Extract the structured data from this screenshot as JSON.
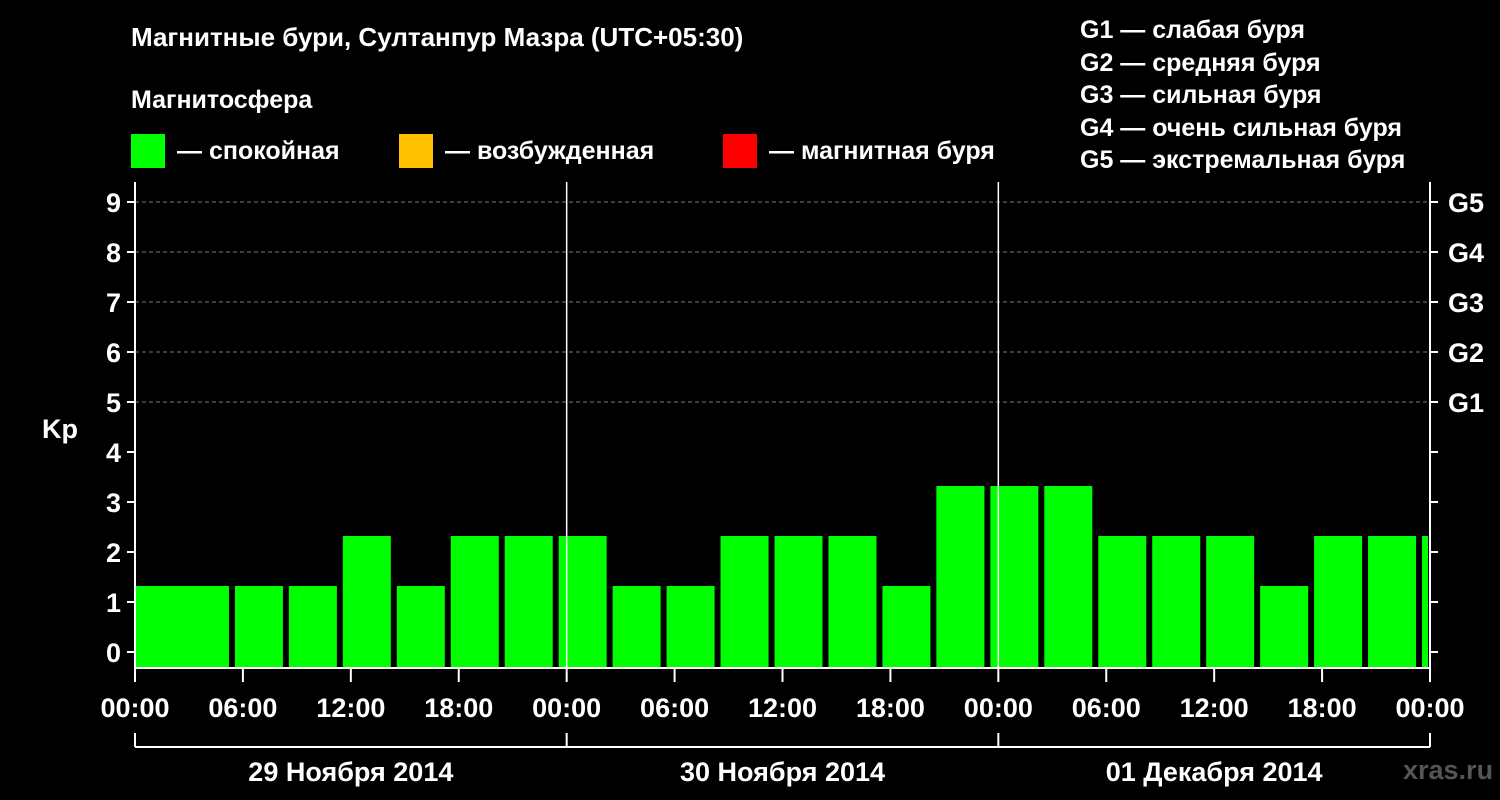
{
  "header": {
    "title": "Магнитные бури, Султанпур Мазра (UTC+05:30)",
    "magnetosphere_title": "Магнитосфера"
  },
  "legend": [
    {
      "color": "#00ff00",
      "label": "— спокойная"
    },
    {
      "color": "#ffc000",
      "label": "— возбужденная"
    },
    {
      "color": "#ff0000",
      "label": "— магнитная буря"
    }
  ],
  "g_legend": [
    "G1 — слабая буря",
    "G2 — средняя буря",
    "G3 — сильная буря",
    "G4 — очень сильная буря",
    "G5 — экстремальная буря"
  ],
  "watermark": "xras.ru",
  "chart_data": {
    "type": "bar",
    "ylabel": "Kp",
    "ylim": [
      0,
      9
    ],
    "yticks": [
      0,
      1,
      2,
      3,
      4,
      5,
      6,
      7,
      8,
      9
    ],
    "right_labels": [
      {
        "y": 5,
        "label": "G1"
      },
      {
        "y": 6,
        "label": "G2"
      },
      {
        "y": 7,
        "label": "G3"
      },
      {
        "y": 8,
        "label": "G4"
      },
      {
        "y": 9,
        "label": "G5"
      }
    ],
    "grid_y": [
      5,
      6,
      7,
      8,
      9
    ],
    "x_hours_range": [
      0,
      72
    ],
    "x_ticks": [
      "00:00",
      "06:00",
      "12:00",
      "18:00",
      "00:00",
      "06:00",
      "12:00",
      "18:00",
      "00:00",
      "06:00",
      "12:00",
      "18:00",
      "00:00"
    ],
    "day_labels": [
      "29 Ноября 2014",
      "30 Ноября 2014",
      "01 Декабря 2014"
    ],
    "bar_color": "#00ff00",
    "bars": [
      {
        "start_hour": 0,
        "value": 1
      },
      {
        "start_hour": 2.5,
        "value": 1
      },
      {
        "start_hour": 5.5,
        "value": 1
      },
      {
        "start_hour": 8.5,
        "value": 1
      },
      {
        "start_hour": 11.5,
        "value": 2
      },
      {
        "start_hour": 14.5,
        "value": 1
      },
      {
        "start_hour": 17.5,
        "value": 2
      },
      {
        "start_hour": 20.5,
        "value": 2
      },
      {
        "start_hour": 23.5,
        "value": 2
      },
      {
        "start_hour": 26.5,
        "value": 1
      },
      {
        "start_hour": 29.5,
        "value": 1
      },
      {
        "start_hour": 32.5,
        "value": 2
      },
      {
        "start_hour": 35.5,
        "value": 2
      },
      {
        "start_hour": 38.5,
        "value": 2
      },
      {
        "start_hour": 41.5,
        "value": 1
      },
      {
        "start_hour": 44.5,
        "value": 3
      },
      {
        "start_hour": 47.5,
        "value": 3
      },
      {
        "start_hour": 50.5,
        "value": 3
      },
      {
        "start_hour": 53.5,
        "value": 2
      },
      {
        "start_hour": 56.5,
        "value": 2
      },
      {
        "start_hour": 59.5,
        "value": 2
      },
      {
        "start_hour": 62.5,
        "value": 1
      },
      {
        "start_hour": 65.5,
        "value": 2
      },
      {
        "start_hour": 68.5,
        "value": 2
      },
      {
        "start_hour": 71.5,
        "value": 2
      }
    ]
  }
}
